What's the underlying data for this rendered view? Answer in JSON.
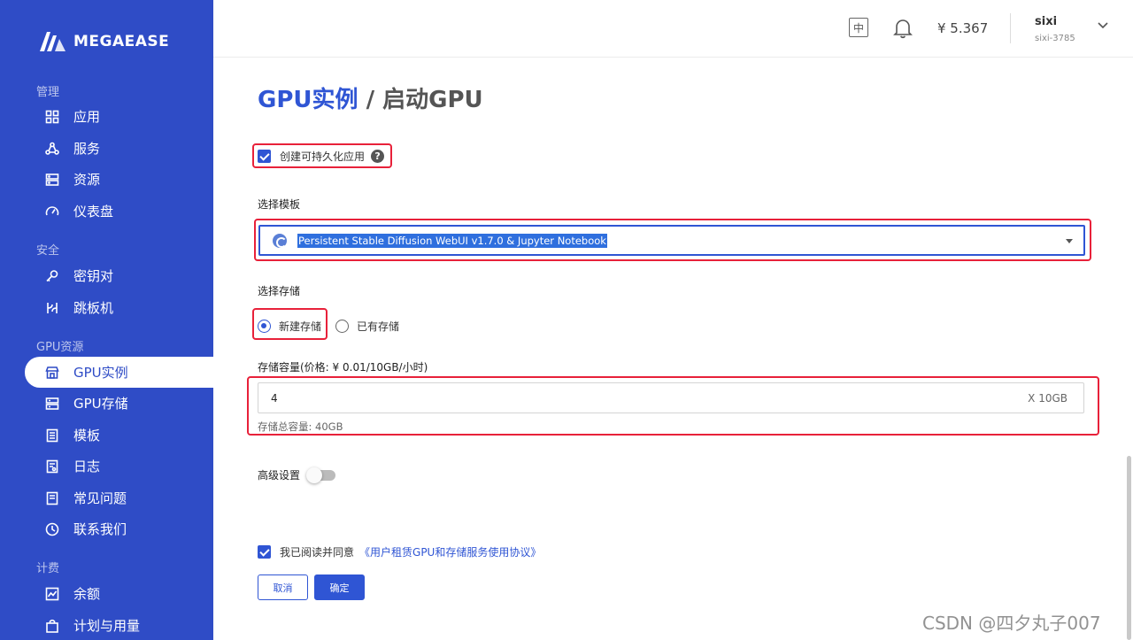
{
  "brand": {
    "name": "MEGAEASE"
  },
  "sidebar": {
    "sections": [
      {
        "title": "管理",
        "items": [
          {
            "label": "应用",
            "icon": "grid-icon"
          },
          {
            "label": "服务",
            "icon": "service-icon"
          },
          {
            "label": "资源",
            "icon": "server-icon"
          },
          {
            "label": "仪表盘",
            "icon": "gauge-icon"
          }
        ]
      },
      {
        "title": "安全",
        "items": [
          {
            "label": "密钥对",
            "icon": "key-icon"
          },
          {
            "label": "跳板机",
            "icon": "jump-host-icon"
          }
        ]
      },
      {
        "title": "GPU资源",
        "items": [
          {
            "label": "GPU实例",
            "icon": "store-icon",
            "active": true
          },
          {
            "label": "GPU存储",
            "icon": "storage-icon"
          },
          {
            "label": "模板",
            "icon": "template-icon"
          },
          {
            "label": "日志",
            "icon": "log-icon"
          },
          {
            "label": "常见问题",
            "icon": "faq-icon"
          },
          {
            "label": "联系我们",
            "icon": "clock-icon"
          }
        ]
      },
      {
        "title": "计费",
        "items": [
          {
            "label": "余额",
            "icon": "chart-icon"
          },
          {
            "label": "计划与用量",
            "icon": "bag-icon"
          }
        ]
      }
    ]
  },
  "header": {
    "lang_label": "中",
    "balance": "¥ 5.367",
    "user": {
      "name": "sixi",
      "id": "sixi-3785"
    }
  },
  "page": {
    "breadcrumb_link": "GPU实例",
    "breadcrumb_separator": " / ",
    "breadcrumb_current": "启动GPU"
  },
  "form": {
    "persistent_checkbox_label": "创建可持久化应用",
    "persistent_checked": true,
    "help_glyph": "?",
    "template_label": "选择模板",
    "template_selected": "Persistent Stable Diffusion WebUI v1.7.0 & Jupyter Notebook",
    "storage_label": "选择存储",
    "storage_options": [
      {
        "label": "新建存储",
        "checked": true
      },
      {
        "label": "已有存储",
        "checked": false
      }
    ],
    "capacity_label": "存储容量(价格: ¥ 0.01/10GB/小时)",
    "capacity_value": "4",
    "capacity_unit": "X 10GB",
    "capacity_total": "存储总容量: 40GB",
    "advanced_label": "高级设置",
    "advanced_enabled": false,
    "agree_label": "我已阅读并同意",
    "agree_link": "《用户租赁GPU和存储服务使用协议》",
    "agree_checked": true,
    "cancel_label": "取消",
    "confirm_label": "确定"
  },
  "watermark": "CSDN @四夕丸子007",
  "colors": {
    "sidebar_bg": "#2f4cc6",
    "primary": "#2f55d4",
    "highlight_box": "#e8213a"
  }
}
